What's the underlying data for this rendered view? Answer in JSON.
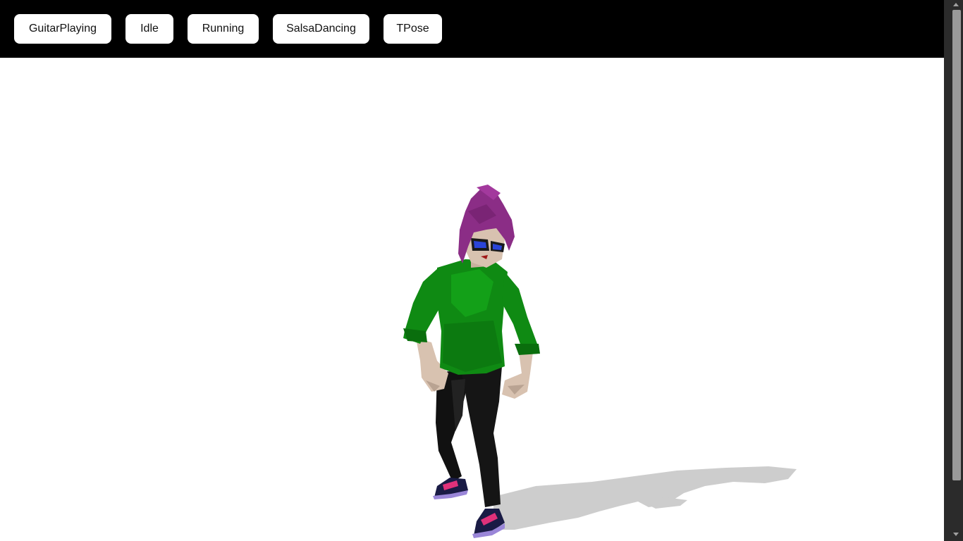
{
  "toolbar": {
    "buttons": [
      {
        "label": "GuitarPlaying"
      },
      {
        "label": "Idle"
      },
      {
        "label": "Running"
      },
      {
        "label": "SalsaDancing"
      },
      {
        "label": "TPose"
      }
    ]
  },
  "scene": {
    "background": "#ffffff",
    "character": {
      "hair_color": "#8b2d86",
      "shirt_color": "#0f8a13",
      "pants_color": "#111111",
      "shoe_color": "#1a1b45",
      "shoe_strap_color": "#e0317a",
      "skin_color": "#d8c2b0"
    },
    "shadow_color": "#c8c8c8"
  },
  "colors": {
    "toolbar_bg": "#000000",
    "button_bg": "#ffffff",
    "scrollbar_track": "#2b2b2b",
    "scrollbar_thumb": "#9a9a9a"
  }
}
